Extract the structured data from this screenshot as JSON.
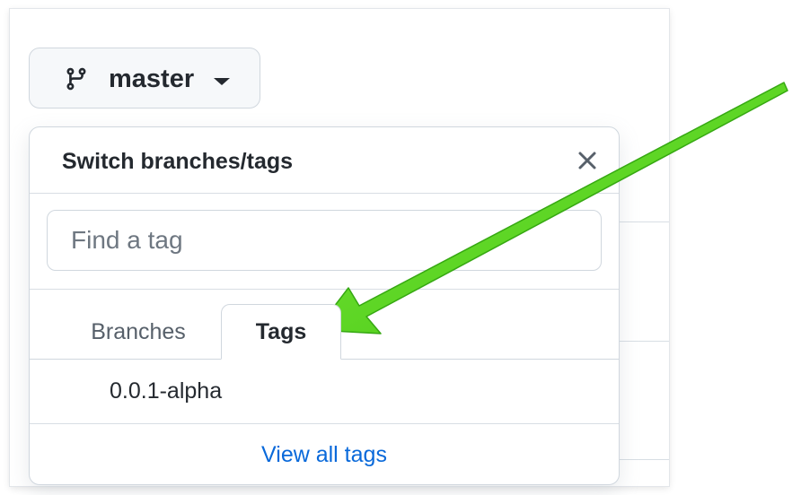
{
  "branch_selector": {
    "current_branch": "master",
    "icon": "git-branch-icon"
  },
  "dropdown": {
    "title": "Switch branches/tags",
    "close_icon": "close-icon",
    "filter": {
      "placeholder": "Find a tag",
      "value": ""
    },
    "tabs": [
      {
        "label": "Branches",
        "selected": false
      },
      {
        "label": "Tags",
        "selected": true
      }
    ],
    "tag_items": [
      {
        "name": "0.0.1-alpha"
      }
    ],
    "footer_link": "View all tags"
  },
  "annotation": {
    "type": "arrow",
    "color": "#4fd819",
    "points_to": "Tags"
  },
  "colors": {
    "link": "#0969da",
    "border": "#d0d7de",
    "button_bg": "#f6f8fa",
    "arrow": "#4fd819"
  }
}
